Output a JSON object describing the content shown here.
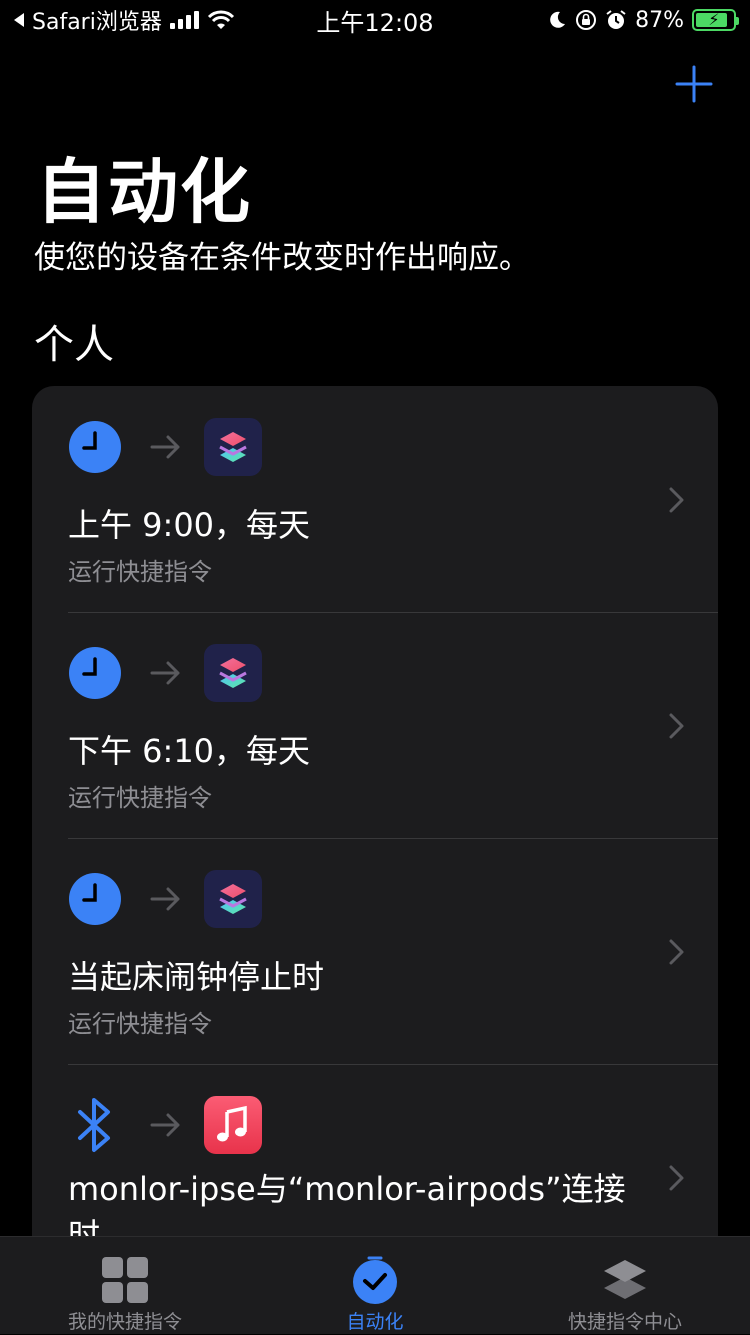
{
  "status_bar": {
    "back_app": "Safari浏览器",
    "time": "上午12:08",
    "battery": "87%",
    "battery_level": 0.87
  },
  "header": {
    "title": "自动化",
    "subtitle": "使您的设备在条件改变时作出响应。",
    "section": "个人"
  },
  "automations": [
    {
      "trigger_icon": "clock-icon",
      "action_icon": "shortcuts-icon",
      "title": "上午 9:00，每天",
      "subtitle": "运行快捷指令"
    },
    {
      "trigger_icon": "clock-icon",
      "action_icon": "shortcuts-icon",
      "title": "下午 6:10，每天",
      "subtitle": "运行快捷指令"
    },
    {
      "trigger_icon": "clock-icon",
      "action_icon": "shortcuts-icon",
      "title": "当起床闹钟停止时",
      "subtitle": "运行快捷指令"
    },
    {
      "trigger_icon": "bluetooth-icon",
      "action_icon": "music-icon",
      "title": "monlor-ipse与“monlor-airpods”连接时",
      "subtitle": ""
    }
  ],
  "tab_bar": {
    "tabs": [
      {
        "label": "我的快捷指令",
        "icon": "grid-icon",
        "active": false
      },
      {
        "label": "自动化",
        "icon": "automation-check-icon",
        "active": true
      },
      {
        "label": "快捷指令中心",
        "icon": "layers-icon",
        "active": false
      }
    ]
  },
  "colors": {
    "accent": "#3b82f6",
    "background": "#000000",
    "card": "#1c1c1e",
    "secondary_text": "#8e8e93",
    "battery": "#4cd964"
  }
}
